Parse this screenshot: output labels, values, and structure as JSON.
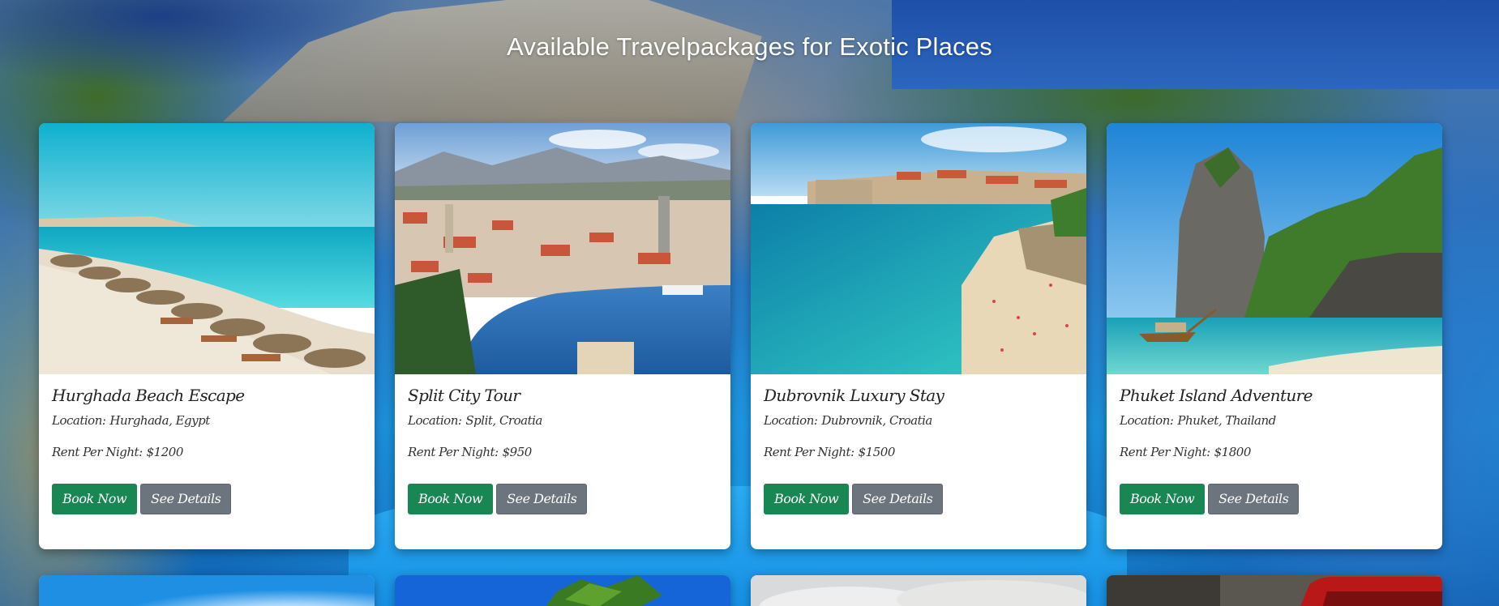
{
  "header": {
    "title": "Available Travelpackages for Exotic Places"
  },
  "colors": {
    "book_button": "#198754",
    "details_button": "#6c757d"
  },
  "packages": [
    {
      "title": "Hurghada Beach Escape",
      "location_label": "Location:",
      "location": "Hurghada, Egypt",
      "rent_label": "Rent Per Night:",
      "rent": "$1200",
      "book_label": "Book Now",
      "details_label": "See Details",
      "image": "beach-with-umbrellas-image"
    },
    {
      "title": "Split City Tour",
      "location_label": "Location:",
      "location": "Split, Croatia",
      "rent_label": "Rent Per Night:",
      "rent": "$950",
      "book_label": "Book Now",
      "details_label": "See Details",
      "image": "harbor-city-image"
    },
    {
      "title": "Dubrovnik Luxury Stay",
      "location_label": "Location:",
      "location": "Dubrovnik, Croatia",
      "rent_label": "Rent Per Night:",
      "rent": "$1500",
      "book_label": "Book Now",
      "details_label": "See Details",
      "image": "old-town-beach-image"
    },
    {
      "title": "Phuket Island Adventure",
      "location_label": "Location:",
      "location": "Phuket, Thailand",
      "rent_label": "Rent Per Night:",
      "rent": "$1800",
      "book_label": "Book Now",
      "details_label": "See Details",
      "image": "limestone-island-image"
    }
  ],
  "next_row_images": [
    "sunny-sky-image",
    "palm-tree-image",
    "cloudy-sky-image",
    "red-car-street-image"
  ]
}
